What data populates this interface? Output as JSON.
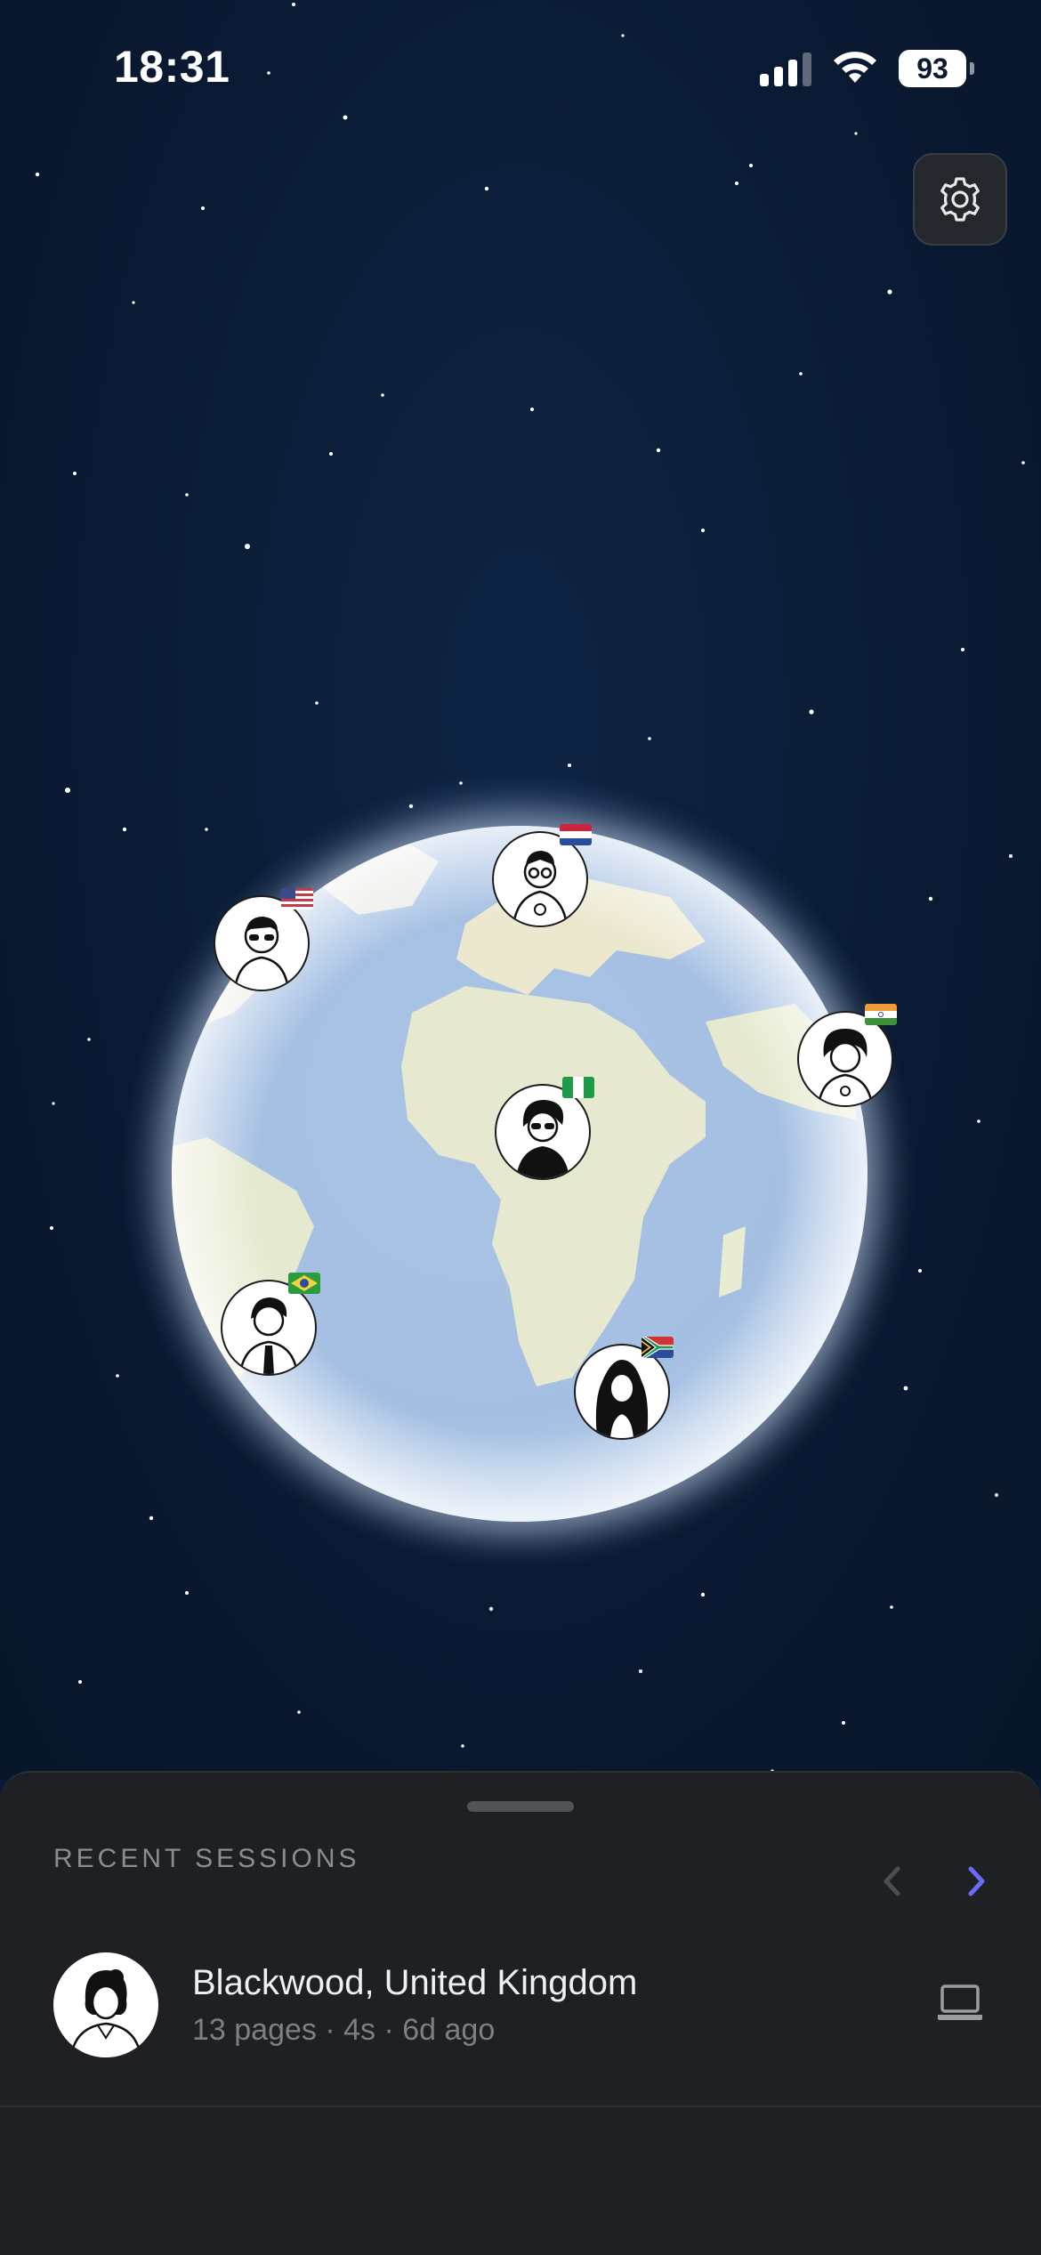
{
  "status_bar": {
    "time": "18:31",
    "battery": "93"
  },
  "settings": {
    "icon": "gear-icon"
  },
  "globe": {
    "markers": [
      {
        "name": "us",
        "flag": "us",
        "avatar": "man-sunglasses"
      },
      {
        "name": "nl",
        "flag": "nl",
        "avatar": "man-glasses"
      },
      {
        "name": "in",
        "flag": "in",
        "avatar": "woman-curly"
      },
      {
        "name": "ng",
        "flag": "ng",
        "avatar": "woman-sunglasses"
      },
      {
        "name": "br",
        "flag": "br",
        "avatar": "man-tie"
      },
      {
        "name": "za",
        "flag": "za",
        "avatar": "woman-hijab"
      }
    ]
  },
  "sheet": {
    "title": "RECENT SESSIONS",
    "prev_icon": "chevron-left-icon",
    "next_icon": "chevron-right-icon",
    "session": {
      "location": "Blackwood, United Kingdom",
      "meta": "13 pages · 4s · 6d ago",
      "device_icon": "laptop-icon"
    }
  },
  "colors": {
    "accent": "#6b6cf6",
    "background": "#0b1a33",
    "sheet": "#1e2023"
  }
}
